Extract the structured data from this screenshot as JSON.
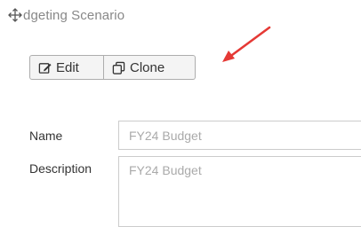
{
  "header": {
    "title": "dgeting Scenario",
    "icon": "move-icon"
  },
  "toolbar": {
    "edit_label": "Edit",
    "edit_icon": "edit-icon",
    "clone_label": "Clone",
    "clone_icon": "clone-icon"
  },
  "annotation": {
    "arrow_color": "#e53935",
    "arrow_icon": "red-arrow"
  },
  "form": {
    "name_label": "Name",
    "name_value": "FY24 Budget",
    "description_label": "Description",
    "description_value": "FY24 Budget"
  }
}
